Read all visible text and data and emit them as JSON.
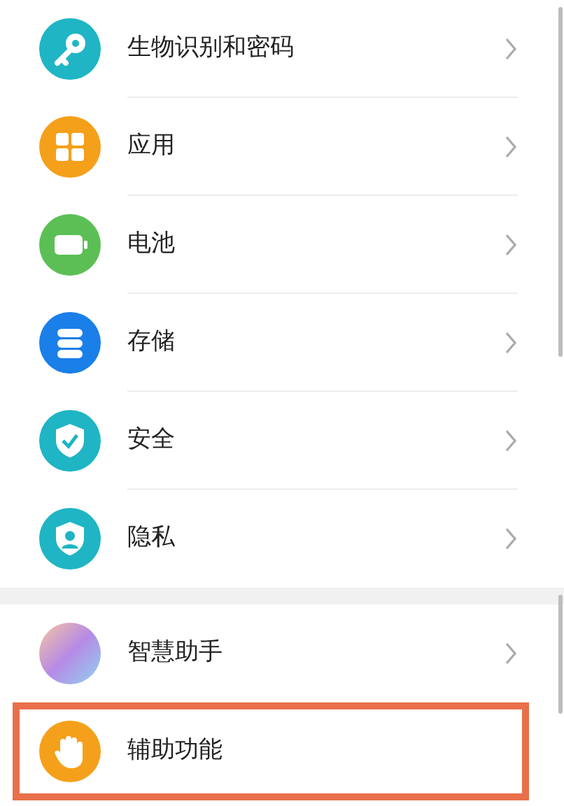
{
  "groups": [
    {
      "items": [
        {
          "label": "生物识别和密码",
          "kind": "key",
          "color": "#1fb5c4",
          "chevron": true,
          "highlighted": false
        },
        {
          "label": "应用",
          "kind": "grid",
          "color": "#f5a01a",
          "chevron": true,
          "highlighted": false
        },
        {
          "label": "电池",
          "kind": "battery",
          "color": "#5cbf55",
          "chevron": true,
          "highlighted": false
        },
        {
          "label": "存储",
          "kind": "storage",
          "color": "#1a7fe8",
          "chevron": true,
          "highlighted": false
        },
        {
          "label": "安全",
          "kind": "shield-check",
          "color": "#1fb5c4",
          "chevron": true,
          "highlighted": false
        },
        {
          "label": "隐私",
          "kind": "shield-person",
          "color": "#1fb5c4",
          "chevron": true,
          "highlighted": false
        }
      ]
    },
    {
      "items": [
        {
          "label": "智慧助手",
          "kind": "assistant",
          "chevron": true,
          "highlighted": false
        },
        {
          "label": "辅助功能",
          "kind": "hand",
          "color": "#f5a01a",
          "chevron": false,
          "highlighted": true
        }
      ]
    }
  ]
}
